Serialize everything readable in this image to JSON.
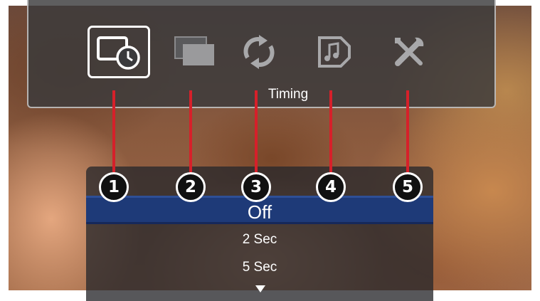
{
  "toolbar": {
    "icons": [
      {
        "name": "slideshow-timing-icon",
        "selected": true
      },
      {
        "name": "transition-icon",
        "selected": false
      },
      {
        "name": "repeat-icon",
        "selected": false
      },
      {
        "name": "music-icon",
        "selected": false
      },
      {
        "name": "settings-icon",
        "selected": false
      }
    ],
    "active_label": "Timing"
  },
  "menu": {
    "selected": "Off",
    "options": [
      "2 Sec",
      "5 Sec"
    ]
  },
  "callouts": [
    "1",
    "2",
    "3",
    "4",
    "5"
  ],
  "colors": {
    "callout_line": "#d6202a",
    "selection_bar": "#1e3a78",
    "panel": "#3a3a3c"
  }
}
